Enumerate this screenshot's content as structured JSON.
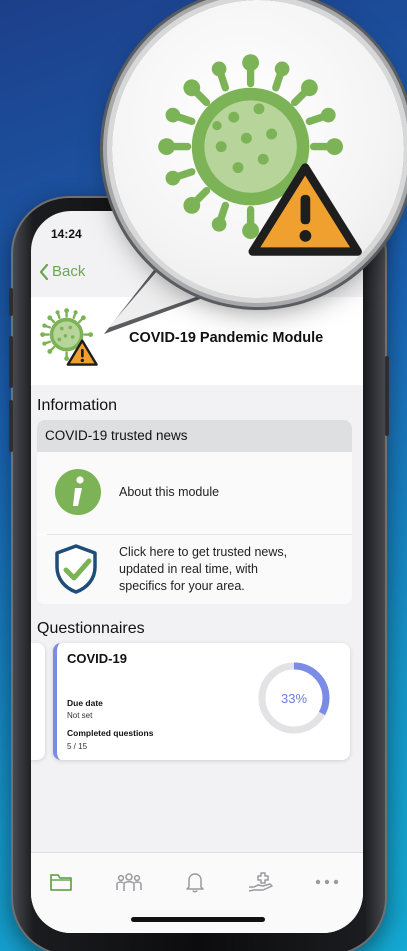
{
  "status": {
    "time": "14:24"
  },
  "nav": {
    "back_label": "Back"
  },
  "module": {
    "title": "COVID-19 Pandemic Module"
  },
  "information": {
    "section_title": "Information",
    "group_title": "COVID-19 trusted news",
    "rows": [
      {
        "label": "About this module",
        "icon": "info-icon"
      },
      {
        "label_lines": [
          "Click here to get trusted news,",
          "updated in real time, with",
          "specifics for your area."
        ],
        "icon": "shield-check-icon"
      }
    ]
  },
  "questionnaires": {
    "section_title": "Questionnaires",
    "card": {
      "title": "COVID-19",
      "due_date_label": "Due date",
      "due_date_value": "Not set",
      "completed_label": "Completed questions",
      "completed_value": "5 / 15",
      "progress_text": "33%",
      "progress_fraction": 0.33
    }
  },
  "tabbar": {
    "icons": [
      "folder-icon",
      "people-icon",
      "bell-icon",
      "health-hand-icon",
      "more-icon"
    ]
  },
  "colors": {
    "accent_green": "#6aa84f",
    "virus_green": "#7cb356",
    "warning_orange": "#f0a02e",
    "progress_blue": "#7b8ce6",
    "progress_track": "#e3e3e6"
  }
}
